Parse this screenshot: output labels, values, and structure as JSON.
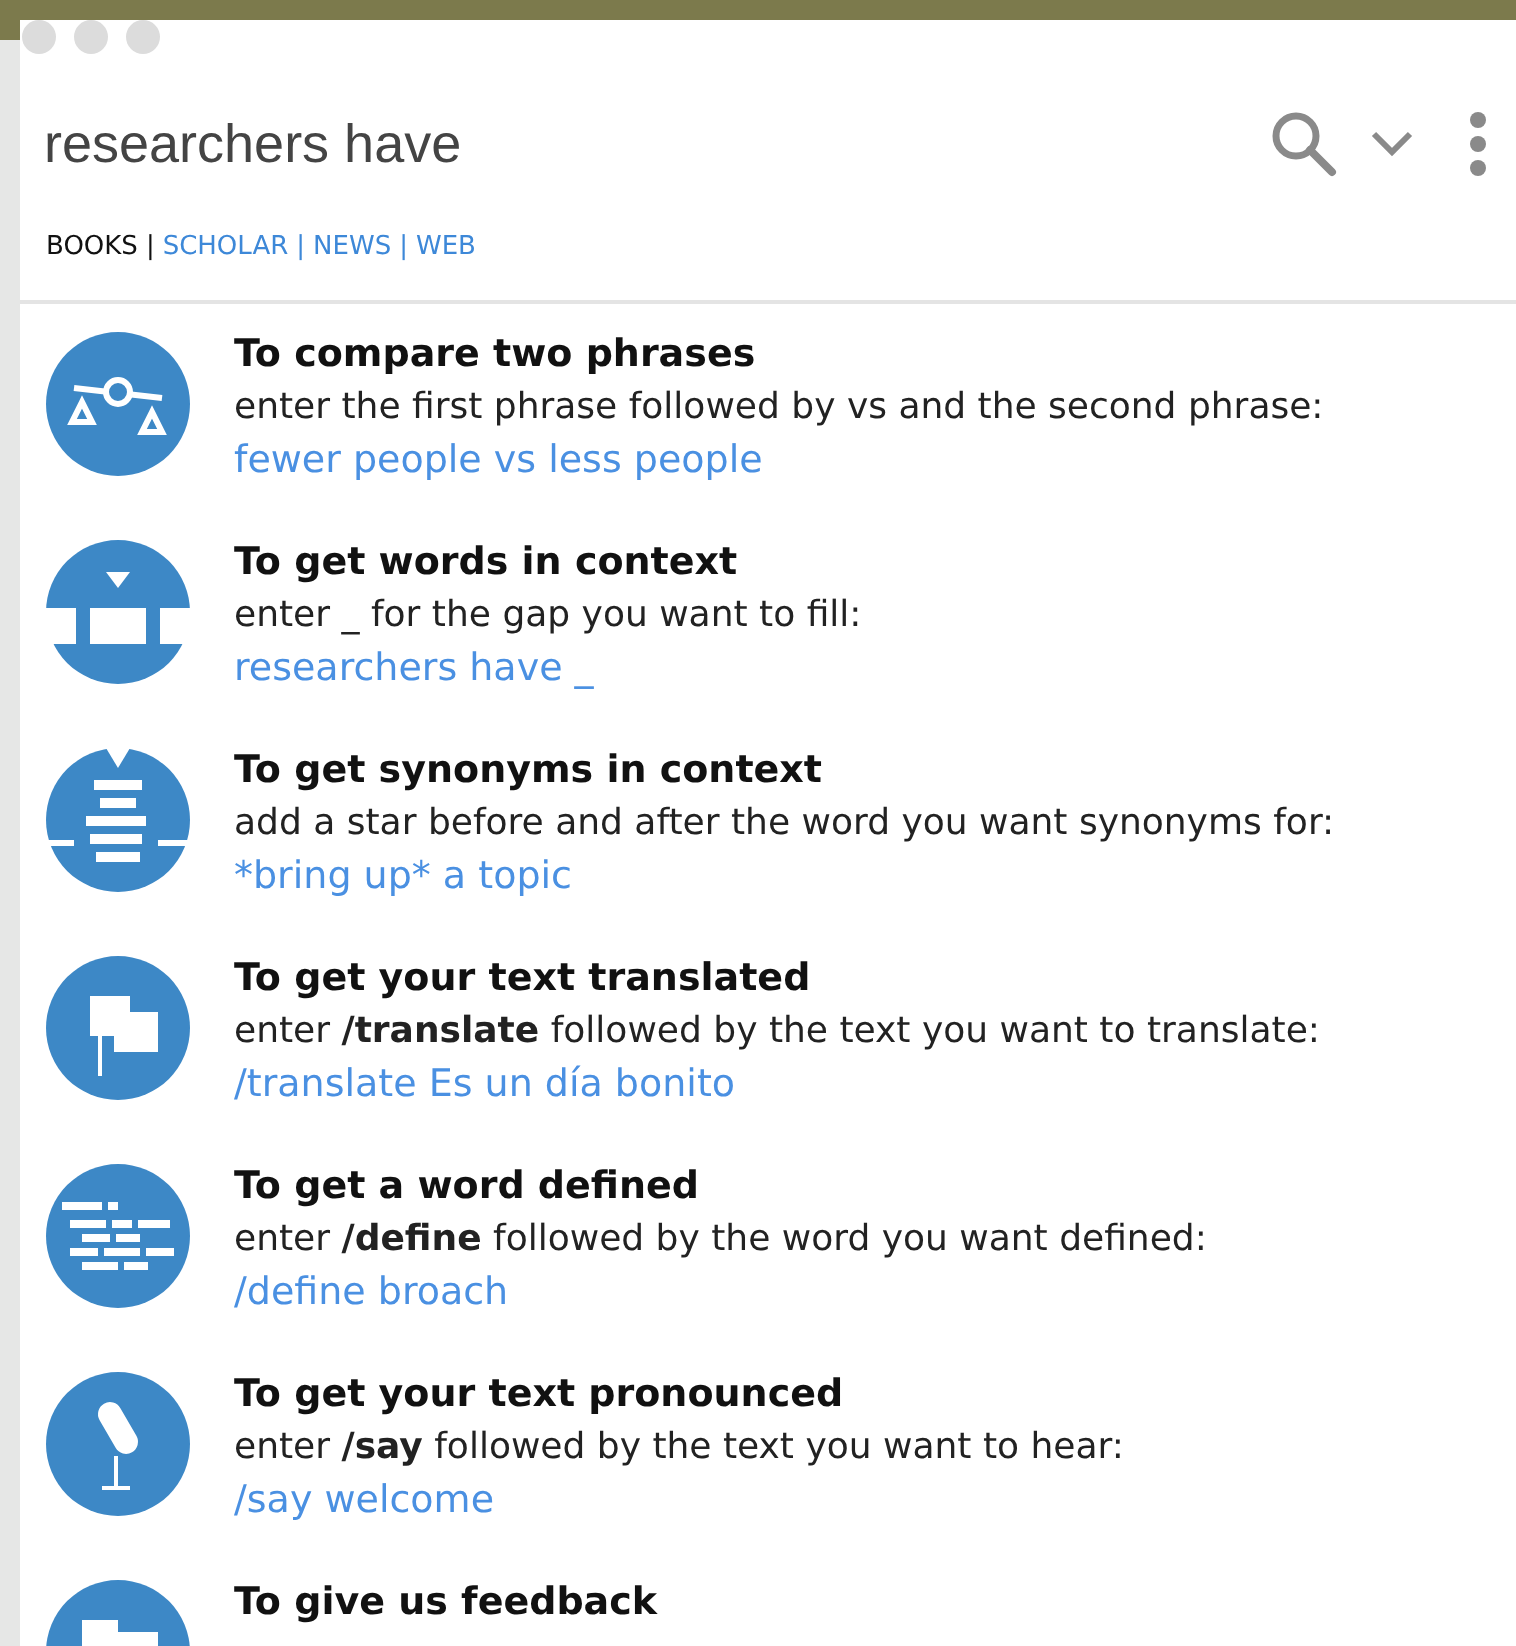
{
  "search": {
    "value": "researchers have"
  },
  "tabs": [
    {
      "label": "BOOKS",
      "selected": true
    },
    {
      "label": "SCHOLAR",
      "selected": false
    },
    {
      "label": "NEWS",
      "selected": false
    },
    {
      "label": "WEB",
      "selected": false
    }
  ],
  "tab_separators": [
    "|",
    "|",
    "|"
  ],
  "tips": [
    {
      "kind": "compare",
      "title": "To compare two phrases",
      "description": "enter the first phrase followed by vs and the second phrase:",
      "example": "fewer people vs less people"
    },
    {
      "kind": "context",
      "title": "To get words in context",
      "description": "enter _ for the gap you want to fill:",
      "example": "researchers have _"
    },
    {
      "kind": "synonyms",
      "title": "To get synonyms in context",
      "description": "add a star before and after the word you want synonyms for:",
      "example": "*bring up* a topic"
    },
    {
      "kind": "translate",
      "title": "To get your text translated",
      "description": "enter **/translate** followed by the text you want to translate:",
      "example": "/translate Es un día bonito"
    },
    {
      "kind": "define",
      "title": "To get a word defined",
      "description": "enter **/define** followed by the word you want defined:",
      "example": "/define broach"
    },
    {
      "kind": "pronounce",
      "title": "To get your text pronounced",
      "description": "enter **/say** followed by the text you want to hear:",
      "example": "/say welcome"
    },
    {
      "kind": "feedback",
      "title": "To give us feedback"
    }
  ]
}
